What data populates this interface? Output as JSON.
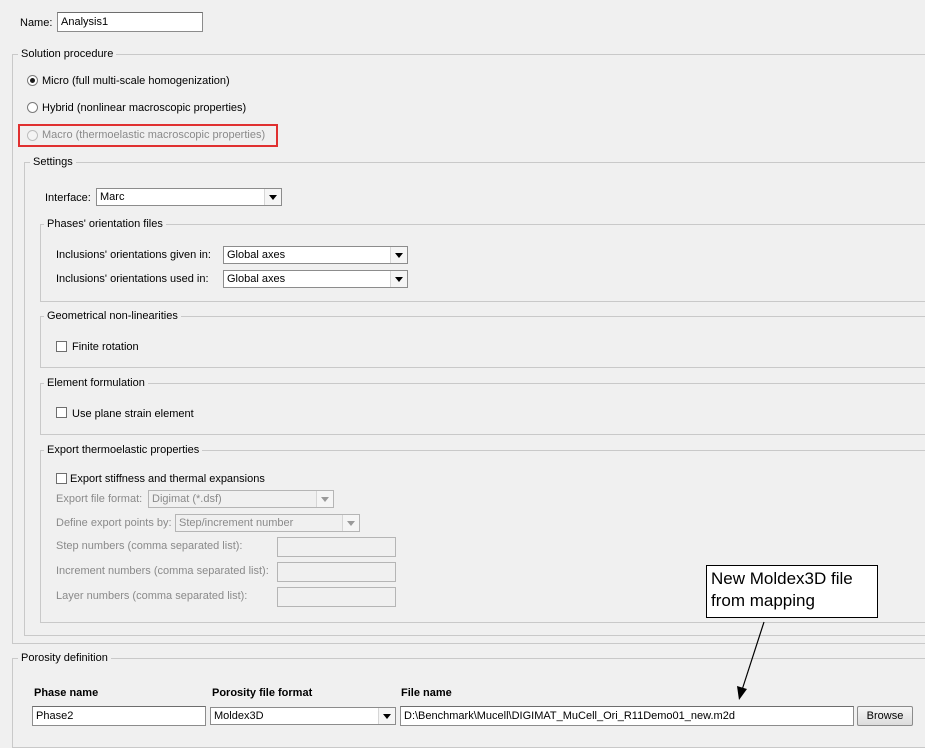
{
  "name": {
    "label": "Name:",
    "value": "Analysis1"
  },
  "solution_procedure": {
    "title": "Solution procedure",
    "options": [
      {
        "label": "Micro (full multi-scale homogenization)",
        "checked": true,
        "disabled": false
      },
      {
        "label": "Hybrid (nonlinear macroscopic properties)",
        "checked": false,
        "disabled": false
      },
      {
        "label": "Macro (thermoelastic macroscopic properties)",
        "checked": false,
        "disabled": true
      }
    ],
    "highlight_color": "#e03030"
  },
  "settings": {
    "title": "Settings",
    "interface": {
      "label": "Interface:",
      "value": "Marc"
    },
    "phases_orientation": {
      "title": "Phases' orientation files",
      "given_in": {
        "label": "Inclusions' orientations given in:",
        "value": "Global axes"
      },
      "used_in": {
        "label": "Inclusions' orientations used in:",
        "value": "Global axes"
      }
    },
    "geometrical": {
      "title": "Geometrical non-linearities",
      "finite_rotation": {
        "label": "Finite rotation",
        "checked": false
      }
    },
    "element_formulation": {
      "title": "Element formulation",
      "plane_strain": {
        "label": "Use plane strain element",
        "checked": false
      }
    },
    "export": {
      "title": "Export thermoelastic properties",
      "stiffness": {
        "label": "Export stiffness and thermal expansions",
        "checked": false
      },
      "file_format": {
        "label": "Export file format:",
        "value": "Digimat (*.dsf)"
      },
      "export_points": {
        "label": "Define export points by:",
        "value": "Step/increment number"
      },
      "step_numbers": {
        "label": "Step numbers (comma separated list):",
        "value": ""
      },
      "increment_numbers": {
        "label": "Increment numbers (comma separated list):",
        "value": ""
      },
      "layer_numbers": {
        "label": "Layer numbers (comma separated list):",
        "value": ""
      }
    }
  },
  "porosity": {
    "title": "Porosity definition",
    "columns": [
      "Phase name",
      "Porosity file format",
      "File name"
    ],
    "row": {
      "phase_name": "Phase2",
      "file_format": "Moldex3D",
      "file_name": "D:\\Benchmark\\Mucell\\DIGIMAT_MuCell_Ori_R11Demo01_new.m2d",
      "browse_label": "Browse"
    }
  },
  "annotation": {
    "line1": "New Moldex3D file",
    "line2": "from mapping"
  }
}
